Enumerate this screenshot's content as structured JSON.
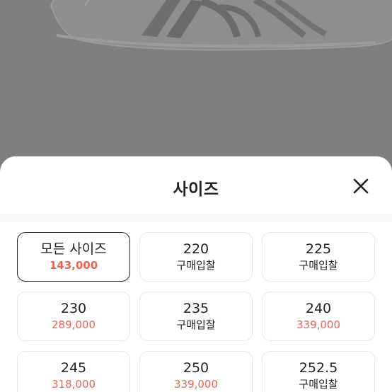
{
  "sheet": {
    "title": "사이즈",
    "close_icon": "close-icon"
  },
  "sizes": [
    {
      "label": "모든 사이즈",
      "sub": "143,000",
      "kind": "price",
      "selected": true
    },
    {
      "label": "220",
      "sub": "구매입찰",
      "kind": "bid",
      "selected": false
    },
    {
      "label": "225",
      "sub": "구매입찰",
      "kind": "bid",
      "selected": false
    },
    {
      "label": "230",
      "sub": "289,000",
      "kind": "price",
      "selected": false
    },
    {
      "label": "235",
      "sub": "구매입찰",
      "kind": "bid",
      "selected": false
    },
    {
      "label": "240",
      "sub": "339,000",
      "kind": "price",
      "selected": false
    },
    {
      "label": "245",
      "sub": "318,000",
      "kind": "price",
      "selected": false
    },
    {
      "label": "250",
      "sub": "339,000",
      "kind": "price",
      "selected": false
    },
    {
      "label": "252.5",
      "sub": "구매입찰",
      "kind": "bid",
      "selected": false
    }
  ],
  "colors": {
    "price": "#ef6253",
    "text": "#222222",
    "overlay": "#7f7f7f"
  }
}
